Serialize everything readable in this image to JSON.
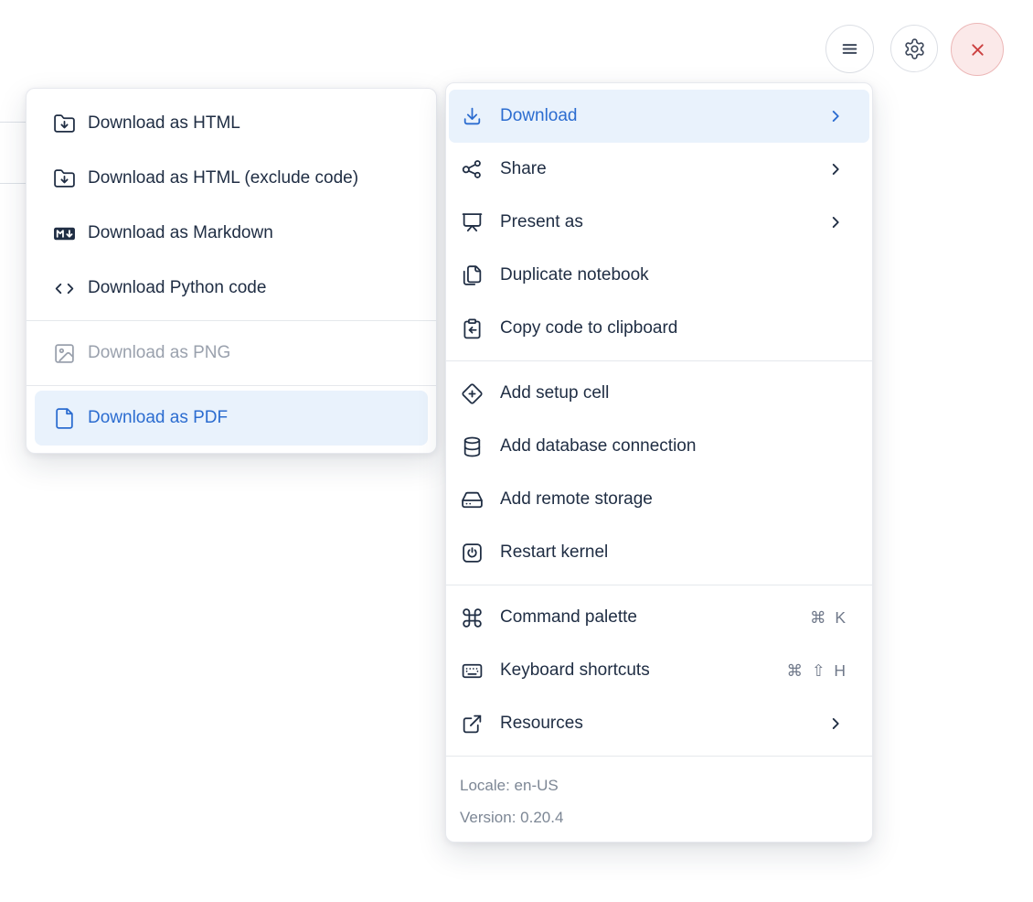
{
  "toolbar": {
    "menu_button": {
      "icon": "hamburger-icon"
    },
    "settings_button": {
      "icon": "gear-icon"
    },
    "close_button": {
      "icon": "x-icon"
    }
  },
  "download_submenu": {
    "items": [
      {
        "label": "Download as HTML",
        "icon": "folder-download-icon"
      },
      {
        "label": "Download as HTML (exclude code)",
        "icon": "folder-download-icon"
      },
      {
        "label": "Download as Markdown",
        "icon": "markdown-badge-icon"
      },
      {
        "label": "Download Python code",
        "icon": "code-brackets-icon"
      },
      {
        "label": "Download as PNG",
        "icon": "image-icon",
        "state": "disabled"
      },
      {
        "label": "Download as PDF",
        "icon": "file-icon",
        "state": "highlighted"
      }
    ]
  },
  "main_menu": {
    "items": [
      {
        "label": "Download",
        "icon": "download-icon",
        "has_submenu": true,
        "state": "highlighted"
      },
      {
        "label": "Share",
        "icon": "share-icon",
        "has_submenu": true
      },
      {
        "label": "Present as",
        "icon": "presentation-icon",
        "has_submenu": true
      },
      {
        "label": "Duplicate notebook",
        "icon": "duplicate-icon"
      },
      {
        "label": "Copy code to clipboard",
        "icon": "clipboard-copy-icon"
      },
      {
        "label": "Add setup cell",
        "icon": "diamond-plus-icon"
      },
      {
        "label": "Add database connection",
        "icon": "database-icon"
      },
      {
        "label": "Add remote storage",
        "icon": "hard-drive-icon"
      },
      {
        "label": "Restart kernel",
        "icon": "power-square-icon"
      },
      {
        "label": "Command palette",
        "icon": "command-icon",
        "shortcut": "⌘ K"
      },
      {
        "label": "Keyboard shortcuts",
        "icon": "keyboard-icon",
        "shortcut": "⌘ ⇧ H"
      },
      {
        "label": "Resources",
        "icon": "external-link-icon",
        "has_submenu": true
      }
    ],
    "footer": {
      "locale": "Locale: en-US",
      "version": "Version: 0.20.4"
    }
  },
  "colors": {
    "accent_blue": "#2b6cd0",
    "highlight_bg": "#e9f2fc",
    "text": "#202e44",
    "muted": "#70798a",
    "disabled": "#9aa1ad",
    "separator": "#e5e8ec",
    "danger": "#cc4040",
    "danger_bg": "#fbe9e9"
  }
}
